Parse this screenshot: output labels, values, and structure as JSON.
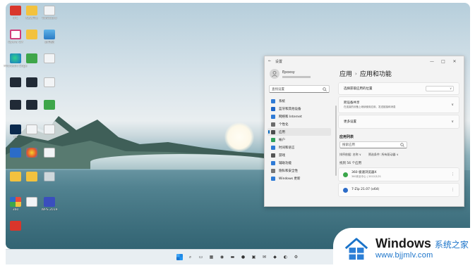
{
  "desktop": {
    "icons": [
      {
        "label": "IPC",
        "icon": "red-app-icon"
      },
      {
        "label": "NewFile",
        "icon": "folder-icon"
      },
      {
        "label": "WINWord",
        "icon": "document-icon"
      },
      {
        "label": "Opera GX",
        "icon": "browser-icon"
      },
      {
        "label": "",
        "icon": "folder-icon"
      },
      {
        "label": "此电脑",
        "icon": "monitor-icon"
      },
      {
        "label": "Microsoft Edge",
        "icon": "edge-icon"
      },
      {
        "label": "",
        "icon": "archive-icon"
      },
      {
        "label": "",
        "icon": "document-icon"
      },
      {
        "label": "",
        "icon": "app-icon"
      },
      {
        "label": "",
        "icon": "app-icon"
      },
      {
        "label": "",
        "icon": "document-icon"
      },
      {
        "label": "",
        "icon": "app-icon"
      },
      {
        "label": "",
        "icon": "app-icon"
      },
      {
        "label": "",
        "icon": "green-app-icon"
      },
      {
        "label": "Ps",
        "icon": "photoshop-icon"
      },
      {
        "label": "",
        "icon": "document-icon"
      },
      {
        "label": "",
        "icon": "document-icon"
      },
      {
        "label": "",
        "icon": "pin-app-icon"
      },
      {
        "label": "",
        "icon": "color-ball-icon"
      },
      {
        "label": "",
        "icon": "document-icon"
      },
      {
        "label": "",
        "icon": "folder-icon"
      },
      {
        "label": "",
        "icon": "folder-icon"
      },
      {
        "label": "",
        "icon": "recycle-bin-icon"
      },
      {
        "label": "360",
        "icon": "multicolor-icon"
      },
      {
        "label": "",
        "icon": "document-icon"
      },
      {
        "label": "WPS 2019",
        "icon": "wps-icon"
      },
      {
        "label": "",
        "icon": "red-app-icon"
      }
    ]
  },
  "settings": {
    "title": "设置",
    "back_glyph": "←",
    "minimize_glyph": "—",
    "maximize_glyph": "□",
    "close_glyph": "✕",
    "user": {
      "name": "Epoxsy"
    },
    "search_placeholder": "查找设置",
    "nav": [
      {
        "label": "系统",
        "color": "#2f7bd6"
      },
      {
        "label": "蓝牙和其他设备",
        "color": "#1e66c7"
      },
      {
        "label": "网络和 Internet",
        "color": "#2f7bd6"
      },
      {
        "label": "个性化",
        "color": "#6b6b6b"
      },
      {
        "label": "应用",
        "color": "#4d4d4d",
        "selected": true
      },
      {
        "label": "帐户",
        "color": "#2fa05b"
      },
      {
        "label": "时间和语言",
        "color": "#2f7bd6"
      },
      {
        "label": "游戏",
        "color": "#555555"
      },
      {
        "label": "辅助功能",
        "color": "#2f7bd6"
      },
      {
        "label": "隐私和安全性",
        "color": "#777777"
      },
      {
        "label": "Windows 更新",
        "color": "#2f7bd6"
      }
    ],
    "breadcrumb": {
      "parent": "应用",
      "sep": "›",
      "current": "应用和功能"
    },
    "cards": [
      {
        "title": "选择获取应用的位置",
        "sub": "",
        "control": "dropdown"
      },
      {
        "title": "跨设备共享",
        "sub": "在连接的设备上继续使用应用、发送链接和消息",
        "control": "chevron"
      },
      {
        "title": "更多设置",
        "sub": "",
        "control": "chevron"
      }
    ],
    "app_list_title": "应用列表",
    "app_search_placeholder": "搜索应用",
    "filters": [
      "排序依据: 名称 ∨",
      "筛选条件: 所有驱动器 ∨"
    ],
    "count_text": "找到 56 个应用",
    "apps": [
      {
        "name": "360 极速浏览器X",
        "meta": "360安全中心 | 2022/3/21",
        "color": "#3aa64a"
      },
      {
        "name": "7-Zip 21.07 (x64)",
        "meta": "",
        "color": "#2c6cc8"
      }
    ],
    "more_glyph": "⋮"
  },
  "taskbar": {
    "items": [
      "start-icon",
      "search-icon",
      "task-view-icon",
      "widgets-icon",
      "chat-icon",
      "file-explorer-icon",
      "browser-icon",
      "store-icon",
      "mail-icon",
      "app-icon",
      "edge-icon",
      "settings-icon"
    ]
  },
  "watermark": {
    "brand": "Windows",
    "cn": "系统之家",
    "url": "www.bjjmlv.com"
  }
}
